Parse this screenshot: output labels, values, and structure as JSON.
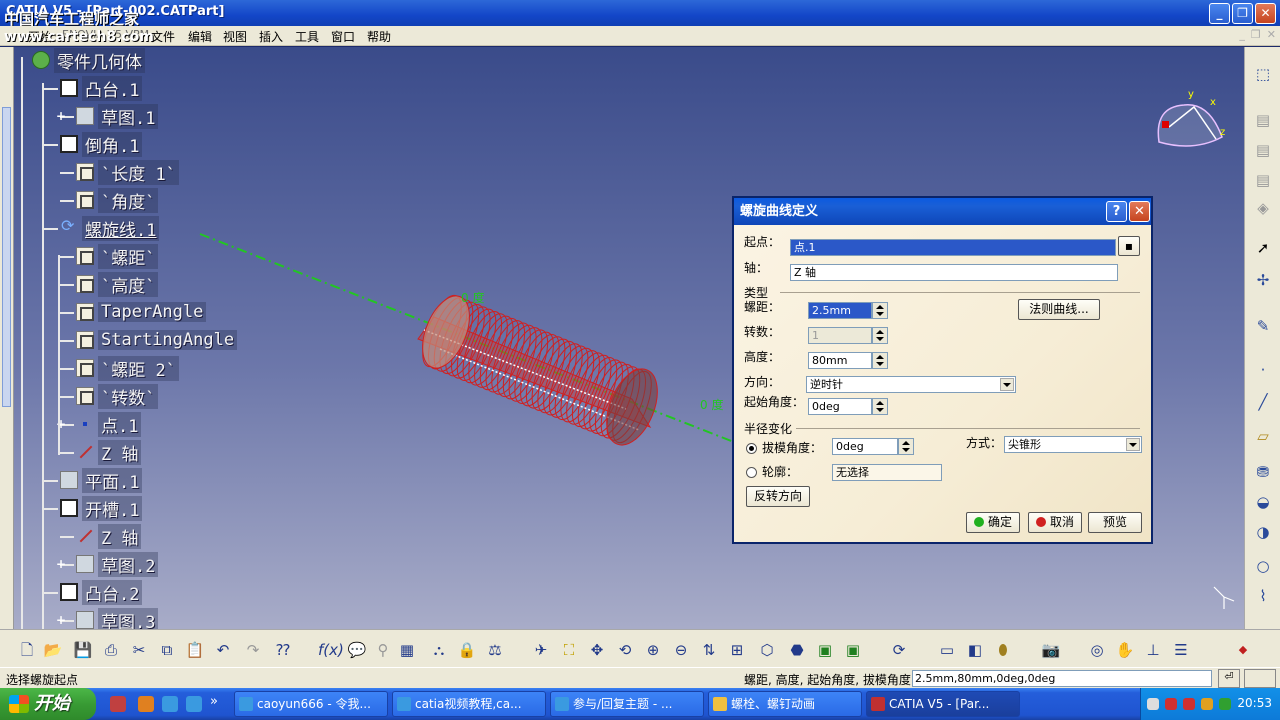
{
  "window": {
    "title": "CATIA V5 - [Part-002.CATPart]",
    "watermark_cn": "中国汽车工程师之家",
    "watermark_url": "www.cartech8.com"
  },
  "menu": [
    "开始",
    "ENOVIA V5 VPM",
    "文件",
    "编辑",
    "视图",
    "插入",
    "工具",
    "窗口",
    "帮助"
  ],
  "tree": {
    "root": "零件几何体",
    "nodes": [
      {
        "label": "凸台.1",
        "icon": "pad-icon"
      },
      {
        "label": "草图.1",
        "icon": "sketch-icon"
      },
      {
        "label": "倒角.1",
        "icon": "chamfer-icon"
      },
      {
        "label": "`长度 1`",
        "icon": "parameter-icon"
      },
      {
        "label": "`角度`",
        "icon": "parameter-icon"
      },
      {
        "label": "螺旋线.1",
        "icon": "helix-icon"
      },
      {
        "label": "`螺距`",
        "icon": "parameter-icon"
      },
      {
        "label": "`高度`",
        "icon": "parameter-icon"
      },
      {
        "label": "TaperAngle",
        "icon": "parameter-icon"
      },
      {
        "label": "StartingAngle",
        "icon": "parameter-icon"
      },
      {
        "label": "`螺距 2`",
        "icon": "parameter-icon"
      },
      {
        "label": "`转数`",
        "icon": "parameter-icon"
      },
      {
        "label": "点.1",
        "icon": "point-icon"
      },
      {
        "label": "Z 轴",
        "icon": "axis-icon"
      },
      {
        "label": "平面.1",
        "icon": "plane-icon"
      },
      {
        "label": "开槽.1",
        "icon": "groove-icon"
      },
      {
        "label": "Z 轴",
        "icon": "axis-icon"
      },
      {
        "label": "草图.2",
        "icon": "sketch-icon"
      },
      {
        "label": "凸台.2",
        "icon": "pad-icon"
      },
      {
        "label": "草图.3",
        "icon": "sketch-icon"
      }
    ]
  },
  "viewport": {
    "label_angle_1": "0 度",
    "label_angle_2": "0 度",
    "compass": {
      "x": "x",
      "y": "y",
      "z": "z"
    }
  },
  "dialog": {
    "title": "螺旋曲线定义",
    "start_point_label": "起点：",
    "start_point_value": "点.1",
    "axis_label": "轴：",
    "axis_value": "Z 轴",
    "type_label": "类型",
    "pitch_label": "螺距：",
    "pitch_value": "2.5mm",
    "law_button": "法则曲线...",
    "revolutions_label": "转数：",
    "revolutions_value": "1",
    "height_label": "高度：",
    "height_value": "80mm",
    "orientation_label": "方向：",
    "orientation_value": "逆时针",
    "start_angle_label": "起始角度：",
    "start_angle_value": "0deg",
    "radius_variation_label": "半径变化",
    "taper_angle_label": "拔模角度：",
    "taper_angle_value": "0deg",
    "way_label": "方式：",
    "way_value": "尖锥形",
    "profile_label": "轮廓：",
    "profile_value": "无选择",
    "reverse_button": "反转方向",
    "ok_button": "确定",
    "cancel_button": "取消",
    "preview_button": "预览"
  },
  "status": {
    "message": "选择螺旋起点",
    "prompt": "螺距, 高度, 起始角度, 拔模角度",
    "input_value": "2.5mm,80mm,0deg,0deg"
  },
  "taskbar": {
    "start_label": "开始",
    "buttons": [
      {
        "label": "caoyun666 - 令我..."
      },
      {
        "label": "catia视频教程,ca..."
      },
      {
        "label": "参与/回复主题 - ..."
      },
      {
        "label": "螺栓、螺钉动画"
      },
      {
        "label": "CATIA V5 - [Par..."
      }
    ],
    "time": "20:53"
  },
  "colors": {
    "title_blue": "#1346c8",
    "helix_red": "#d02020",
    "axis_green": "#22c622",
    "dialog_bg": "#f6edd6"
  }
}
